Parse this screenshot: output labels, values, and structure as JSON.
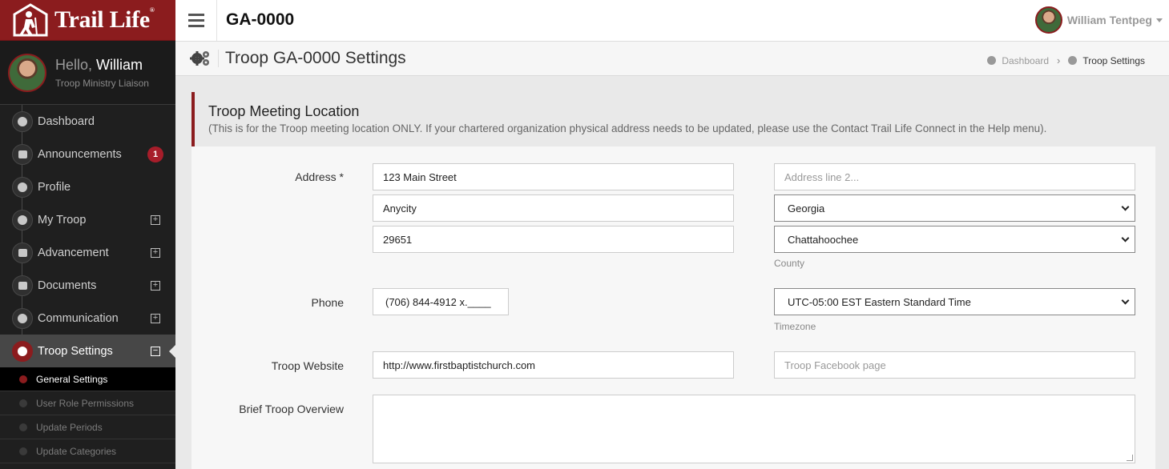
{
  "brand": {
    "name": "Trail Life",
    "mark": "®",
    "logo_icon": "trail-life-logo-icon"
  },
  "user": {
    "greeting": "Hello,",
    "first_name": "William",
    "role": "Troop Ministry Liaison",
    "full_name": "William Tentpeg"
  },
  "sidebar": {
    "items": [
      {
        "label": "Dashboard",
        "icon": "dashboard-icon"
      },
      {
        "label": "Announcements",
        "icon": "megaphone-icon",
        "badge": "1"
      },
      {
        "label": "Profile",
        "icon": "user-icon"
      },
      {
        "label": "My Troop",
        "icon": "users-icon",
        "expand": "+"
      },
      {
        "label": "Advancement",
        "icon": "hiker-icon",
        "expand": "+"
      },
      {
        "label": "Documents",
        "icon": "document-icon",
        "expand": "+"
      },
      {
        "label": "Communication",
        "icon": "envelope-icon",
        "expand": "+"
      },
      {
        "label": "Troop Settings",
        "icon": "cogs-icon",
        "expand": "−"
      }
    ],
    "subitems": [
      {
        "label": "General Settings"
      },
      {
        "label": "User Role Permissions"
      },
      {
        "label": "Update Periods"
      },
      {
        "label": "Update Categories"
      }
    ]
  },
  "topbar": {
    "troop_id": "GA-0000"
  },
  "page": {
    "title": "Troop GA-0000 Settings",
    "breadcrumb": {
      "home": "Dashboard",
      "separator": "›",
      "current": "Troop Settings"
    }
  },
  "section": {
    "title": "Troop Meeting Location",
    "note": "(This is for the Troop meeting location ONLY. If your chartered organization physical address needs to be updated, please use the Contact Trail Life Connect in the Help menu)."
  },
  "form": {
    "address_label": "Address *",
    "address_line1": "123 Main Street",
    "address_line2_placeholder": "Address line 2...",
    "city": "Anycity",
    "state": "Georgia",
    "zip": "29651",
    "county": "Chattahoochee",
    "county_label": "County",
    "phone_label": "Phone",
    "phone": "(706) 844-4912 x.____",
    "timezone": "UTC-05:00 EST Eastern Standard Time",
    "timezone_label": "Timezone",
    "website_label": "Troop Website",
    "website": "http://www.firstbaptistchurch.com",
    "facebook_placeholder": "Troop Facebook page",
    "overview_label": "Brief Troop Overview",
    "overview": ""
  },
  "colors": {
    "brand_red": "#8b1c1e",
    "sidebar_bg": "#1f1f1f",
    "badge_red": "#a71d2a"
  }
}
